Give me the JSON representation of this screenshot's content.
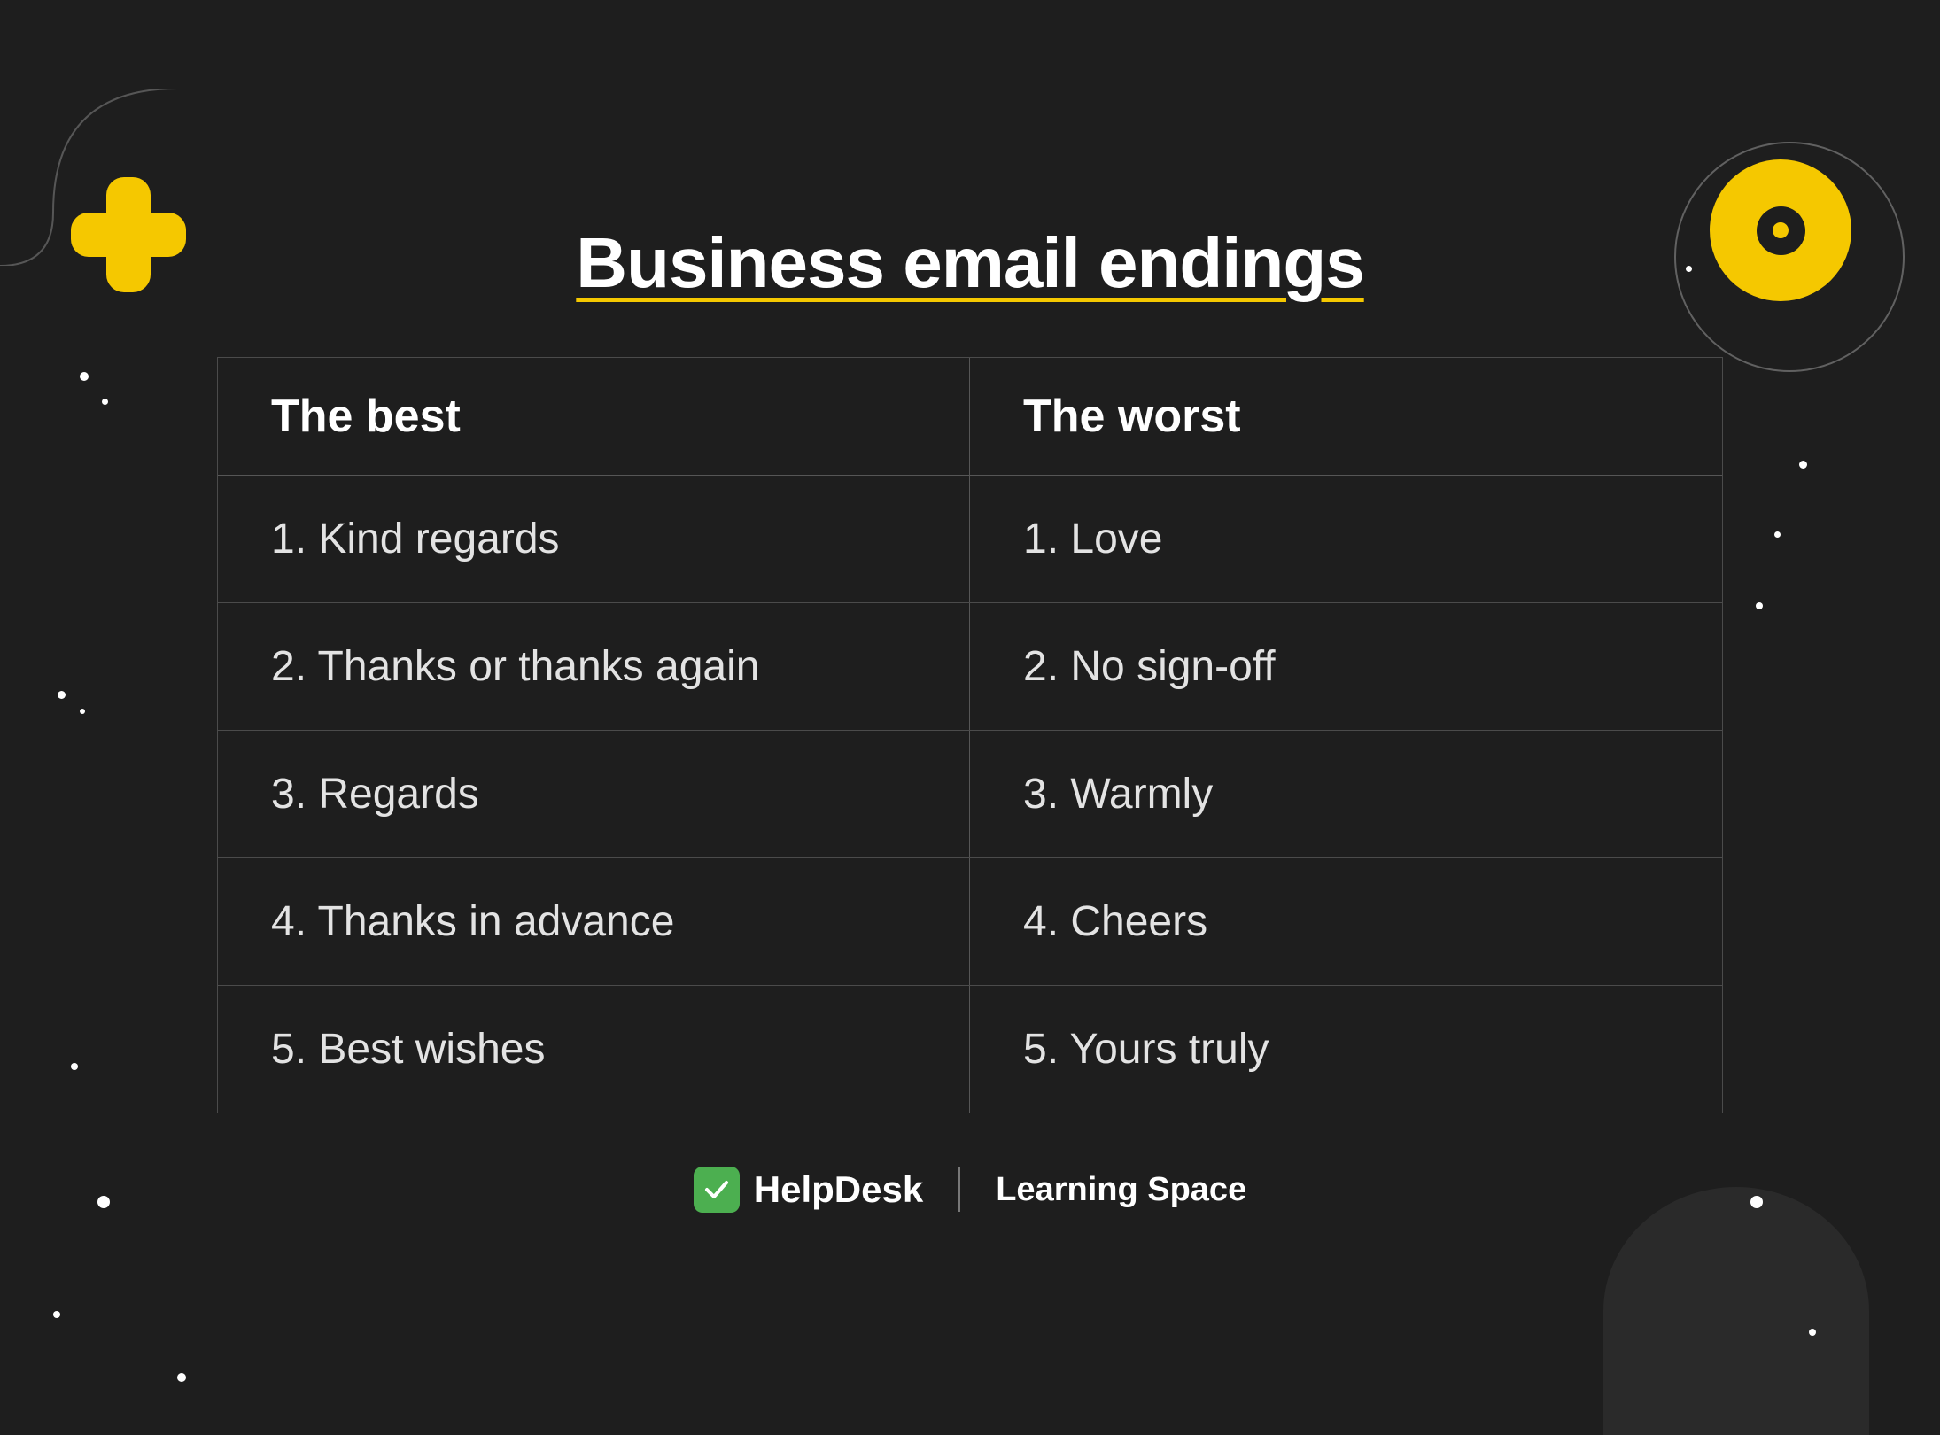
{
  "title": "Business email endings",
  "columns": {
    "best": "The best",
    "worst": "The worst"
  },
  "rows": [
    {
      "best": "1. Kind regards",
      "worst": "1. Love"
    },
    {
      "best": "2. Thanks or thanks again",
      "worst": "2. No sign-off"
    },
    {
      "best": "3. Regards",
      "worst": "3. Warmly"
    },
    {
      "best": "4. Thanks in advance",
      "worst": "4. Cheers"
    },
    {
      "best": "5. Best wishes",
      "worst": "5. Yours truly"
    }
  ],
  "footer": {
    "brand": "HelpDesk",
    "section": "Learning Space"
  },
  "colors": {
    "background": "#1e1e1e",
    "accent": "#f5c800",
    "text": "#ffffff",
    "cell_text": "rgba(255,255,255,0.88)"
  }
}
